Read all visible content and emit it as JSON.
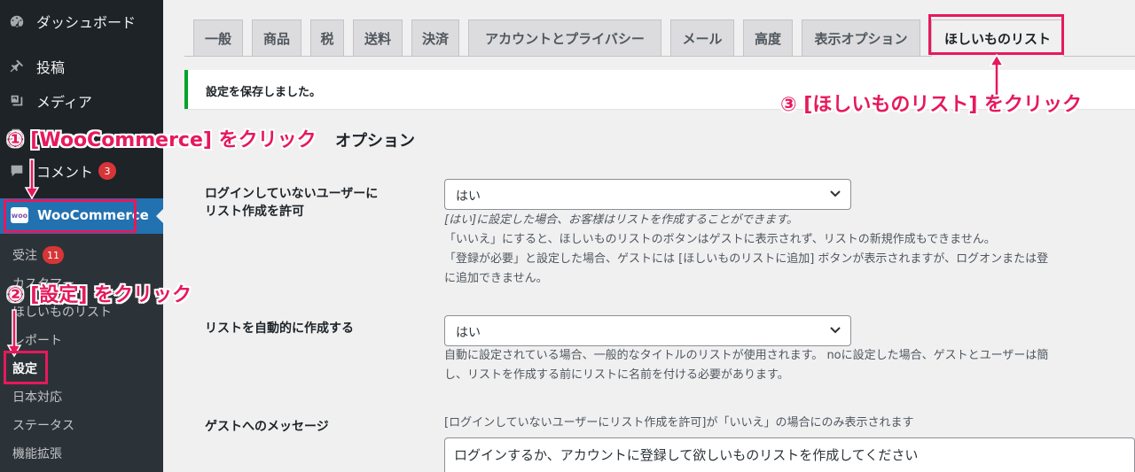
{
  "sidebar": {
    "items": [
      {
        "label": "ダッシュボード",
        "icon": "dashboard-icon"
      },
      {
        "label": "投稿",
        "icon": "pin-icon"
      },
      {
        "label": "メディア",
        "icon": "media-icon"
      },
      {
        "label": "",
        "icon": ""
      },
      {
        "label": "コメント",
        "icon": "comment-icon",
        "badge": "3"
      }
    ],
    "woocommerce_label": "WooCommerce",
    "woo_logo_text": "woo",
    "submenu": [
      {
        "label": "受注",
        "badge": "11"
      },
      {
        "label": "カスタマー"
      },
      {
        "label": "ほしいものリスト"
      },
      {
        "label": "レポート"
      },
      {
        "label": "設定"
      },
      {
        "label": "日本対応"
      },
      {
        "label": "ステータス"
      },
      {
        "label": "機能拡張"
      }
    ]
  },
  "tabs": [
    "一般",
    "商品",
    "税",
    "送料",
    "決済",
    "アカウントとプライバシー",
    "メール",
    "高度",
    "表示オプション",
    "ほしいものリスト"
  ],
  "notice": "設定を保存しました。",
  "section_title": "オプション",
  "fields": {
    "login_label_1": "ログインしていないユーザーに",
    "login_label_2": "リスト作成を許可",
    "login_value": "はい",
    "login_desc": [
      "[はい]に設定した場合、お客様はリストを作成することができます。",
      "「いいえ」にすると、ほしいものリストのボタンはゲストに表示されず、リストの新規作成もできません。",
      "「登録が必要」と設定した場合、ゲストには [ほしいものリストに追加] ボタンが表示されますが、ログオンまたは登",
      "に追加できません。"
    ],
    "auto_label": "リストを自動的に作成する",
    "auto_value": "はい",
    "auto_desc": [
      "自動に設定されている場合、一般的なタイトルのリストが使用されます。 noに設定した場合、ゲストとユーザーは簡",
      "し、リストを作成する前にリストに名前を付ける必要があります。"
    ],
    "guest_label": "ゲストへのメッセージ",
    "guest_note": "[ログインしていないユーザーにリスト作成を許可]が「いいえ」の場合にのみ表示されます",
    "guest_message": "ログインするか、アカウントに登録して欲しいものリストを作成してください"
  },
  "annotations": {
    "step1": "① [WooCommerce] をクリック",
    "step2": "② [設定] をクリック",
    "step3": "③ [ほしいものリスト] をクリック",
    "color": "#e6195c"
  },
  "colors": {
    "sidebar_bg": "#1d2327",
    "accent": "#2271b1",
    "success": "#00a32a",
    "badge": "#d63638"
  }
}
